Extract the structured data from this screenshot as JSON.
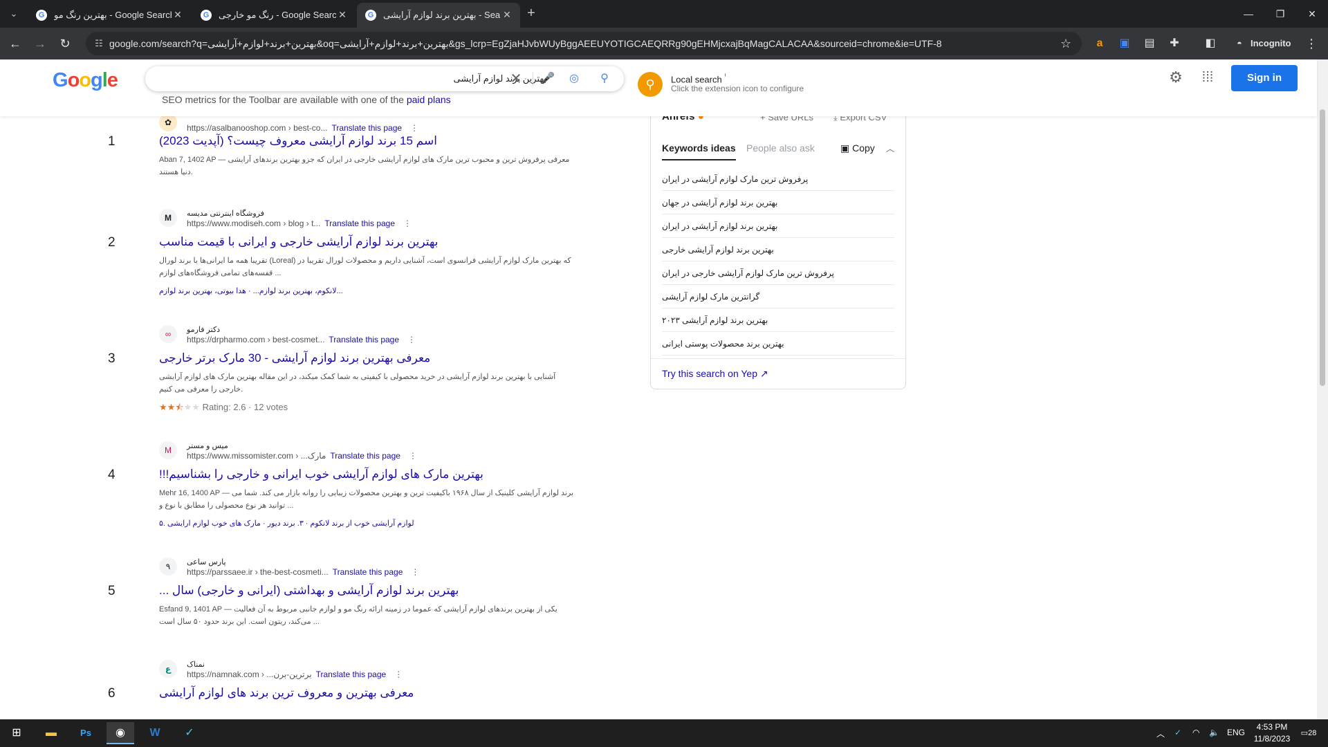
{
  "browser": {
    "tabs": [
      {
        "title": "بهترین رنگ مو - Google Search",
        "active": false
      },
      {
        "title": "رنگ مو خارجی - Google Search",
        "active": false
      },
      {
        "title": "بهترین برند لوازم آرایشی - Search",
        "active": true
      }
    ],
    "url": "google.com/search?q=بهترین+برند+لوازم+آرایشی&oq=بهترین+برند+لوازم+آرایشی&gs_lcrp=EgZjaHJvbWUyBggAEEUYOTIGCAEQRRg90gEHMjcxajBqMagCALACAA&sourceid=chrome&ie=UTF-8",
    "incognito_label": "Incognito",
    "icons": [
      "tab-list-icon",
      "back-icon",
      "forward-icon",
      "reload-icon",
      "site-info-icon",
      "star-icon",
      "amazon-extension-icon",
      "translate-extension-icon",
      "extension-icon",
      "puzzle-icon",
      "sidepanel-icon",
      "incognito-icon",
      "menu-kebab-icon"
    ]
  },
  "google": {
    "logo": "Google",
    "query": "بهترین برند لوازم آرایشی",
    "seo_notice": "SEO metrics for the Toolbar are available with one of the",
    "seo_link": "paid plans",
    "local_search_title": "Local search",
    "local_search_info": "ⁱ",
    "local_search_sub": "Click the extension icon to configure",
    "signin_label": "Sign in"
  },
  "results": [
    {
      "num": "1",
      "site": "",
      "url": "https://asalbanooshop.com › best-co...",
      "translate": "Translate this page",
      "title": "اسم 15 برند لوازم آرایشی معروف چیست؟ (آپدیت 2023)",
      "snippet": "Aban 7, 1402 AP — معرفی پرفروش ترین و محبوب ترین مارک های لوازم آرایشی خارجی در ایران که جزو بهترین برندهای آرایشی دنیا هستند.",
      "links": ""
    },
    {
      "num": "2",
      "site": "فروشگاه اینترنتی مدیسه",
      "url": "https://www.modiseh.com › blog › t...",
      "translate": "Translate this page",
      "title": "بهترین برند لوازم آرایشی خارجی و ایرانی با قیمت مناسب",
      "snippet": "تقریبا همه ما ایرانی‌ها با برند لورال (Loreal) که بهترین مارک لوازم آرایشی فرانسوی است، آشنایی داریم و محصولات لورال تقریبا در قفسه‌های تمامی فروشگاه‌های لوازم ...",
      "links": "لانکوم، بهترین برند لوازم... · هدا بیوتی، بهترین برند لوازم..."
    },
    {
      "num": "3",
      "site": "دکتر فارمو",
      "url": "https://drpharmo.com › best-cosmet...",
      "translate": "Translate this page",
      "title": "معرفی بهترین برند لوازم آرایشی - 30 مارک برتر خارجی",
      "snippet": "آشنایی با بهترین برند لوازم آرایشی در خرید محصولی با کیفیتی به شما کمک میکند، در این مقاله بهترین مارک های لوازم آرایشی خارجی را معرفی می کنیم.",
      "rating": 2.6,
      "rating_text": "Rating: 2.6 · 12 votes",
      "links": ""
    },
    {
      "num": "4",
      "site": "میس و مستر",
      "url": "https://www.missomister.com › ...مارک",
      "translate": "Translate this page",
      "title": "بهترین مارک های لوازم آرایشی خوب ایرانی و خارجی را بشناسیم!!!",
      "snippet": "Mehr 16, 1400 AP — برند لوازم آرایشی کلینیک از سال ۱۹۶۸ باکیفیت ترین و بهترین محصولات زیبایی را روانه بازار می کند. شما می توانید هر نوع محصولی را مطابق با نوع و ...",
      "links": "۵. لوازم آرایشی خوب از برند لانکوم · ۳. برند دیور · مارک های خوب لوازم ارایشی"
    },
    {
      "num": "5",
      "site": "پارس ساعی",
      "url": "https://parssaee.ir › the-best-cosmeti...",
      "translate": "Translate this page",
      "title": "بهترین برند لوازم آرایشی و بهداشتی (ایرانی و خارجی) سال ...",
      "snippet": "Esfand 9, 1401 AP — یکی از بهترین برندهای لوازم آرایشی که عموما در زمینه ارائه رنگ مو و لوازم جانبی مربوط به آن فعالیت می‌کند، ریتون است. این برند حدود ۵۰ سال است ...",
      "links": ""
    },
    {
      "num": "6",
      "site": "نمناک",
      "url": "https://namnak.com › ...برترین-برن",
      "translate": "Translate this page",
      "title": "معرفی بهترین و معروف ترین برند های لوازم آرایشی",
      "snippet": "",
      "links": ""
    }
  ],
  "ahrefs": {
    "brand": "Ahrefs",
    "save_urls": "Save URLs",
    "export_csv": "Export CSV",
    "tab_keywords": "Keywords ideas",
    "tab_people": "People also ask",
    "copy": "Copy",
    "keywords": [
      "پرفروش ترین مارک لوازم آرایشی در ایران",
      "بهترین برند لوازم آرایشی در جهان",
      "بهترین برند لوازم آرایشی در ایران",
      "بهترین برند لوازم آرایشی خارجی",
      "پرفروش ترین مارک لوازم آرایشی خارجی در ایران",
      "گرانترین مارک لوازم آرایشی",
      "بهترین برند لوازم آرایشی ۲۰۲۳",
      "بهترین برند محصولات پوستی ایرانی"
    ],
    "yep_link": "Try this search on Yep"
  },
  "taskbar": {
    "lang": "ENG",
    "time": "4:53 PM",
    "date": "11/8/2023",
    "notifications": "28"
  },
  "colors": {
    "link": "#1a0dab",
    "signin": "#1a73e8",
    "chrome_dark": "#202124"
  }
}
